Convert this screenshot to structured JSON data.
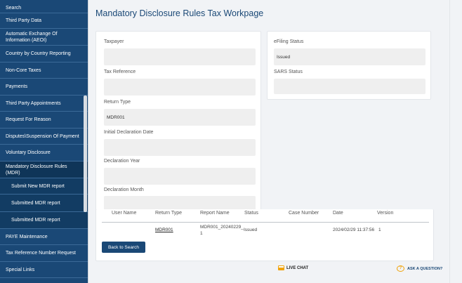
{
  "sidebar": {
    "items": [
      {
        "label": "Search"
      },
      {
        "label": "Third Party Data"
      },
      {
        "label": "Automatic Exchange Of Information (AEOI)"
      },
      {
        "label": "Country by Country Reporting"
      },
      {
        "label": "Non-Core Taxes"
      },
      {
        "label": "Payments"
      },
      {
        "label": "Third Party Appointments"
      },
      {
        "label": "Request For Reason"
      },
      {
        "label": "Disputes\\Suspension Of Payment"
      },
      {
        "label": "Voluntary Disclosure"
      },
      {
        "label": "Mandatory Disclosure Rules (MDR)"
      },
      {
        "label": "Submit New MDR report"
      },
      {
        "label": "Submitted MDR report"
      },
      {
        "label": "Submitted MDR report"
      },
      {
        "label": "PAYE Maintenance"
      },
      {
        "label": "Tax Reference Number Request"
      },
      {
        "label": "Special Links"
      }
    ]
  },
  "page": {
    "title": "Mandatory Disclosure Rules Tax Workpage"
  },
  "form": {
    "taxpayer": {
      "label": "Taxpayer",
      "value": ""
    },
    "tax_reference": {
      "label": "Tax Reference",
      "value": ""
    },
    "return_type": {
      "label": "Return Type",
      "value": "MDR001"
    },
    "initial_declaration_date": {
      "label": "Initial Declaration Date",
      "value": ""
    },
    "declaration_year": {
      "label": "Declaration Year",
      "value": ""
    },
    "declaration_month": {
      "label": "Declaration Month",
      "value": ""
    }
  },
  "status_panel": {
    "efiling_status": {
      "label": "eFiling Status",
      "value": "Issued"
    },
    "sars_status": {
      "label": "SARS Status",
      "value": ""
    }
  },
  "table": {
    "headers": {
      "user_name": "User Name",
      "return_type": "Return Type",
      "report_name": "Report Name",
      "status": "Status",
      "case_number": "Case Number",
      "date": "Date",
      "version": "Version"
    },
    "rows": [
      {
        "user_name": "",
        "return_type": "MDR001",
        "report_name_line1": "MDR001_20240229_",
        "report_name_line2": "1",
        "status": "Issued",
        "case_number": "",
        "date": "2024/02/29 11:37:56",
        "version": "1"
      }
    ]
  },
  "actions": {
    "back_to_search": "Back to Search"
  },
  "footer": {
    "live_chat": "LIVE CHAT",
    "ask_question": "ASK A QUESTION?"
  },
  "colors": {
    "sidebar_bg": "#1a4876",
    "accent": "#f0a30a"
  },
  "icons": {
    "live_chat": "chat-icon",
    "ask_question": "question-bubble-icon"
  }
}
